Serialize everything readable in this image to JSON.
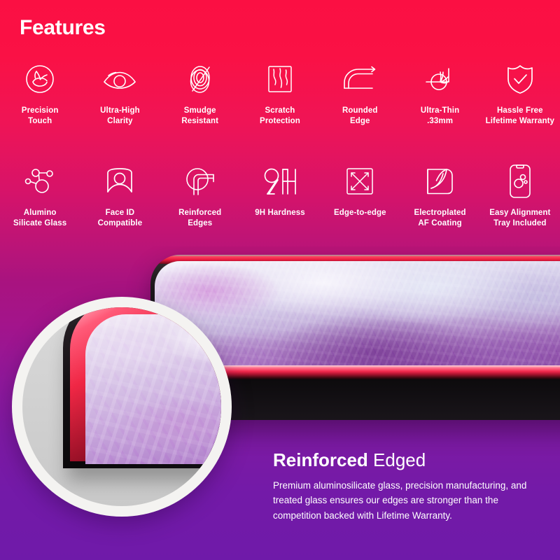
{
  "header": {
    "title": "Features"
  },
  "features": {
    "row1": [
      {
        "icon": "precision-touch-icon",
        "label": "Precision\nTouch"
      },
      {
        "icon": "eye-clarity-icon",
        "label": "Ultra-High\nClarity"
      },
      {
        "icon": "smudge-resistant-icon",
        "label": "Smudge\nResistant"
      },
      {
        "icon": "scratch-protection-icon",
        "label": "Scratch\nProtection"
      },
      {
        "icon": "rounded-edge-icon",
        "label": "Rounded\nEdge"
      },
      {
        "icon": "ultra-thin-icon",
        "label": "Ultra-Thin\n.33mm"
      },
      {
        "icon": "shield-check-icon",
        "label": "Hassle Free\nLifetime Warranty"
      }
    ],
    "row2": [
      {
        "icon": "molecule-icon",
        "label": "Alumino\nSilicate Glass"
      },
      {
        "icon": "face-id-icon",
        "label": "Face ID\nCompatible"
      },
      {
        "icon": "reinforced-edges-icon",
        "label": "Reinforced\nEdges"
      },
      {
        "icon": "nine-h-hardness-icon",
        "label": "9H Hardness"
      },
      {
        "icon": "edge-to-edge-icon",
        "label": "Edge-to-edge"
      },
      {
        "icon": "electroplated-coating-icon",
        "label": "Electroplated\nAF Coating"
      },
      {
        "icon": "alignment-tray-icon",
        "label": "Easy Alignment\nTray Included"
      }
    ]
  },
  "caption": {
    "title_strong": "Reinforced",
    "title_light": " Edged",
    "body": "Premium aluminosilicate glass, precision manufacturing, and treated glass ensures our edges are stronger than the competition backed with Lifetime Warranty."
  },
  "colors": {
    "gradient_top": "#fb0f43",
    "gradient_mid": "#a9137f",
    "gradient_bottom": "#6f1aa9",
    "icon_stroke": "#ffffff",
    "magnifier_ring": "#f4f3f1",
    "magnifier_lens": "#d4d4d4",
    "phone_edge_red": "#f42a4e",
    "phone_body_black": "#120f12"
  }
}
